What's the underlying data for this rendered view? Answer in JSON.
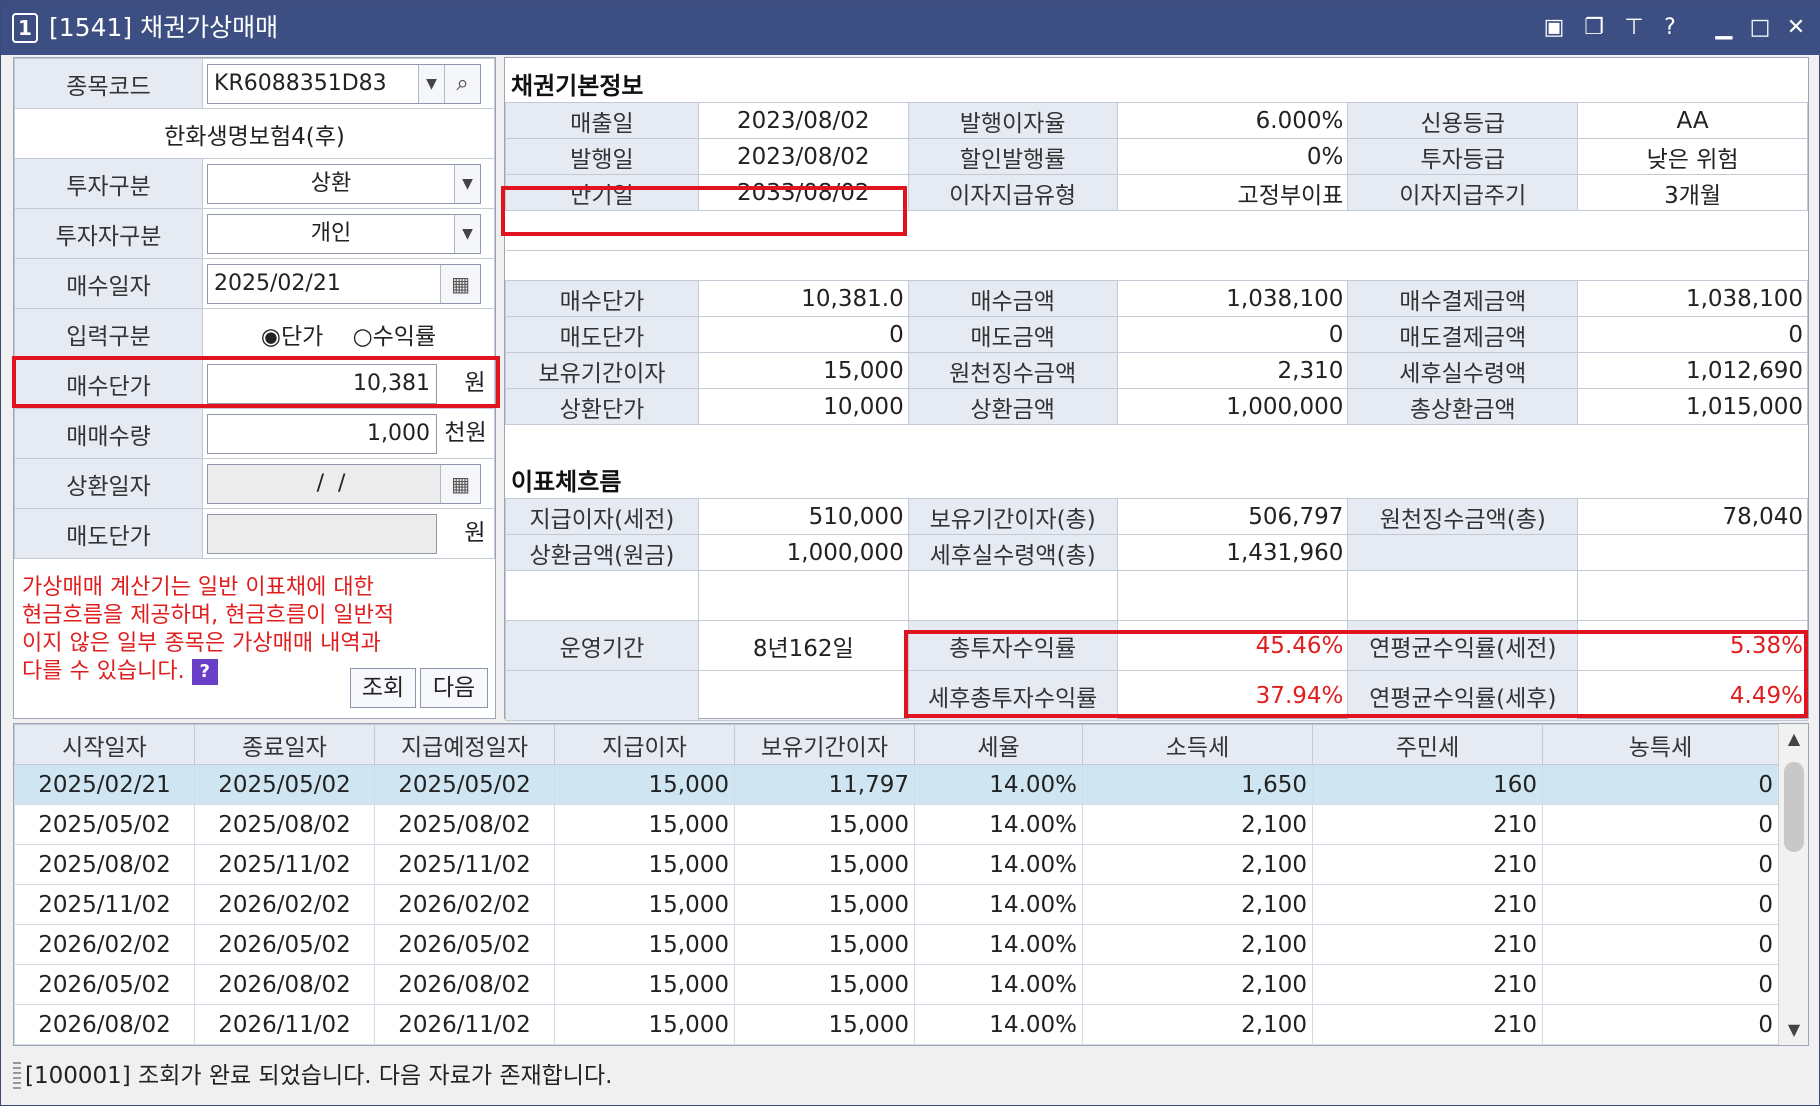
{
  "window": {
    "number": "1",
    "title": "[1541] 채권가상매매"
  },
  "left": {
    "code_label": "종목코드",
    "code_value": "KR6088351D83",
    "bond_name": "한화생명보험4(후)",
    "invest_type_label": "투자구분",
    "invest_type_value": "상환",
    "investor_type_label": "투자자구분",
    "investor_type_value": "개인",
    "buy_date_label": "매수일자",
    "buy_date_value": "2025/02/21",
    "input_type_label": "입력구분",
    "radio_price": "단가",
    "radio_yield": "수익률",
    "buy_price_label": "매수단가",
    "buy_price_value": "10,381",
    "buy_price_unit": "원",
    "qty_label": "매매수량",
    "qty_value": "1,000",
    "qty_unit": "천원",
    "redeem_date_label": "상환일자",
    "redeem_date_value": "  /  /",
    "sell_price_label": "매도단가",
    "sell_price_unit": "원",
    "notice_lines": [
      "가상매매 계산기는 일반 이표채에 대한",
      "현금흐름을 제공하며, 현금흐름이 일반적",
      "이지 않은 일부 종목은 가상매매 내역과",
      "다를 수 있습니다."
    ],
    "help": "?",
    "query_button": "조회",
    "next_button": "다음"
  },
  "basic": {
    "title": "채권기본정보",
    "rows": [
      [
        "매출일",
        "2023/08/02",
        "발행이자율",
        "6.000%",
        "신용등급",
        "AA"
      ],
      [
        "발행일",
        "2023/08/02",
        "할인발행률",
        "0%",
        "투자등급",
        "낮은 위험"
      ],
      [
        "만기일",
        "2033/08/02",
        "이자지급유형",
        "고정부이표",
        "이자지급주기",
        "3개월"
      ]
    ]
  },
  "trade": {
    "rows": [
      [
        "매수단가",
        "10,381.0",
        "매수금액",
        "1,038,100",
        "매수결제금액",
        "1,038,100"
      ],
      [
        "매도단가",
        "0",
        "매도금액",
        "0",
        "매도결제금액",
        "0"
      ],
      [
        "보유기간이자",
        "15,000",
        "원천징수금액",
        "2,310",
        "세후실수령액",
        "1,012,690"
      ],
      [
        "상환단가",
        "10,000",
        "상환금액",
        "1,000,000",
        "총상환금액",
        "1,015,000"
      ]
    ]
  },
  "cashflow": {
    "title": "이표체흐름",
    "rows": [
      [
        "지급이자(세전)",
        "510,000",
        "보유기간이자(총)",
        "506,797",
        "원천징수금액(총)",
        "78,040"
      ],
      [
        "상환금액(원금)",
        "1,000,000",
        "세후실수령액(총)",
        "1,431,960",
        "",
        ""
      ]
    ],
    "period_label": "운영기간",
    "period_value": "8년162일",
    "total_return_label": "총투자수익률",
    "total_return_value": "45.46%",
    "annual_pre_label": "연평균수익률(세전)",
    "annual_pre_value": "5.38%",
    "after_tax_total_label": "세후총투자수익률",
    "after_tax_total_value": "37.94%",
    "annual_post_label": "연평균수익률(세후)",
    "annual_post_value": "4.49%"
  },
  "grid": {
    "headers": [
      "시작일자",
      "종료일자",
      "지급예정일자",
      "지급이자",
      "보유기간이자",
      "세율",
      "소득세",
      "주민세",
      "농특세"
    ],
    "rows": [
      [
        "2025/02/21",
        "2025/05/02",
        "2025/05/02",
        "15,000",
        "11,797",
        "14.00%",
        "1,650",
        "160",
        "0"
      ],
      [
        "2025/05/02",
        "2025/08/02",
        "2025/08/02",
        "15,000",
        "15,000",
        "14.00%",
        "2,100",
        "210",
        "0"
      ],
      [
        "2025/08/02",
        "2025/11/02",
        "2025/11/02",
        "15,000",
        "15,000",
        "14.00%",
        "2,100",
        "210",
        "0"
      ],
      [
        "2025/11/02",
        "2026/02/02",
        "2026/02/02",
        "15,000",
        "15,000",
        "14.00%",
        "2,100",
        "210",
        "0"
      ],
      [
        "2026/02/02",
        "2026/05/02",
        "2026/05/02",
        "15,000",
        "15,000",
        "14.00%",
        "2,100",
        "210",
        "0"
      ],
      [
        "2026/05/02",
        "2026/08/02",
        "2026/08/02",
        "15,000",
        "15,000",
        "14.00%",
        "2,100",
        "210",
        "0"
      ],
      [
        "2026/08/02",
        "2026/11/02",
        "2026/11/02",
        "15,000",
        "15,000",
        "14.00%",
        "2,100",
        "210",
        "0"
      ]
    ]
  },
  "status": "[100001] 조회가 완료 되었습니다. 다음 자료가 존재합니다.",
  "colors": {
    "titlebar": "#3d4f82",
    "highlight": "#e0141e",
    "selected_row": "#cfe6f2",
    "label_bg": "#e6ebf3"
  },
  "icons": [
    "layout-icon",
    "restore-windows-icon",
    "pin-icon",
    "help-icon",
    "minimize-icon",
    "maximize-icon",
    "close-icon",
    "search-icon",
    "dropdown-icon",
    "calendar-icon"
  ]
}
